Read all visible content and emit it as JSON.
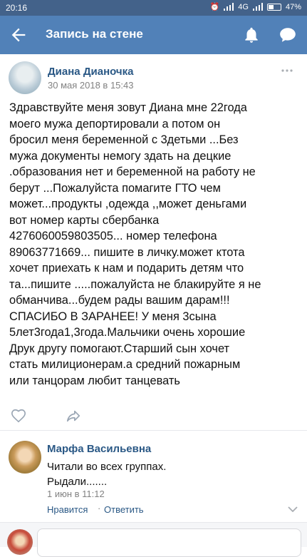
{
  "status_bar": {
    "time": "20:16",
    "network": "4G",
    "battery": "47%",
    "battery_level": 0.47
  },
  "app_bar": {
    "title": "Запись на стене",
    "back_icon": "arrow-left-icon",
    "bell_icon": "bell-icon",
    "messages_icon": "chat-bubble-icon"
  },
  "post": {
    "author": "Диана Дианочка",
    "date": "30 мая 2018 в 15:43",
    "text_lines": [
      "Здравствуйте меня зовут Диана мне 22года",
      "моего мужа депортировали а потом он",
      "бросил меня беременной с 3детьми ...Без",
      "мужа документы немогу здать на децкие",
      ".образования нет и беременной на работу не",
      "берут ...Пожалуйста помагите ГТО чем",
      "может...продукты ,одежда ,,может деньгами",
      "вот номер карты сбербанка",
      "4276060059803505... номер телефона",
      "89063771669... пишите в личку.может ктота",
      "хочет приехать к нам и подарить детям что",
      "та...пишите .....пожалуйста не блакируйте я не",
      "обманчива...будем рады вашим дарам!!!",
      "СПАСИБО В ЗАРАНЕЕ! У меня 3сына",
      "5лет3года1,3года.Мальчики очень хорошие",
      "Друк другу помогают.Старший сын хочет",
      "стать милиционерам.а средний пожарным",
      "или танцорам любит танцевать"
    ]
  },
  "comment": {
    "author": "Марфа Васильевна",
    "text_lines": [
      "Читали во всех группах.",
      "Рыдали......."
    ],
    "date": "1 июн в 11:12",
    "like_label": "Нравится",
    "separator": "·",
    "reply_label": "Ответить"
  },
  "colors": {
    "status_bar": "#43628a",
    "app_bar": "#5181b8",
    "link": "#2a5885",
    "muted": "#828282"
  }
}
